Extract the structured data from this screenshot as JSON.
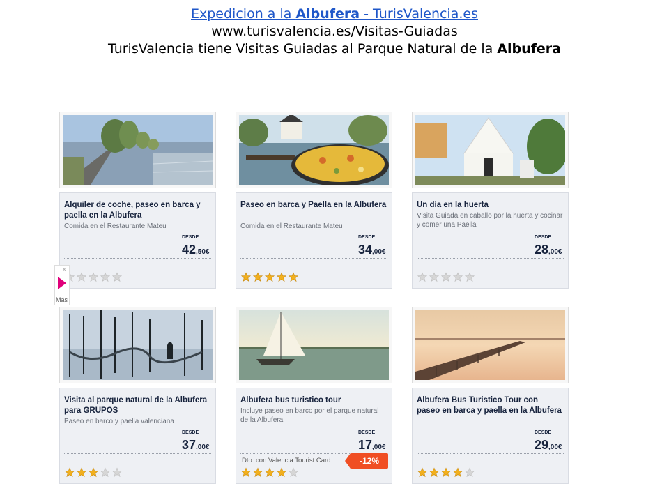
{
  "header": {
    "link_prefix": "Expedicion a la ",
    "link_bold": "Albufera",
    "link_suffix": " - TurisValencia.es",
    "url": "www.turisvalencia.es/Visitas-Guiadas",
    "desc_prefix": "TurisValencia tiene Visitas Guiadas al Parque Natural de la ",
    "desc_bold": "Albufera"
  },
  "side_tab": {
    "close": "×",
    "label": "Más"
  },
  "cards": [
    {
      "title": "Alquiler de coche, paseo en barca y paella en la Albufera",
      "subtitle": "Comida en el Restaurante Mateu",
      "desde": "DESDE",
      "price_int": "42",
      "price_dec": ",50€",
      "rating": 0,
      "promo": "",
      "badge": ""
    },
    {
      "title": "Paseo en barca y Paella en la Albufera",
      "subtitle": "Comida en el Restaurante Mateu",
      "desde": "DESDE",
      "price_int": "34",
      "price_dec": ",00€",
      "rating": 5,
      "promo": "",
      "badge": ""
    },
    {
      "title": "Un día en la huerta",
      "subtitle": "Visita Guiada en caballo por la huerta y cocinar y comer una Paella",
      "desde": "DESDE",
      "price_int": "28",
      "price_dec": ",00€",
      "rating": 0,
      "promo": "",
      "badge": ""
    },
    {
      "title": "Visita al parque natural de la Albufera para GRUPOS",
      "subtitle": "Paseo en barco y paella valenciana",
      "desde": "DESDE",
      "price_int": "37",
      "price_dec": ",00€",
      "rating": 3,
      "promo": "",
      "badge": ""
    },
    {
      "title": "Albufera bus turistico tour",
      "subtitle": "Incluye paseo en barco por el parque natural de la Albufera",
      "desde": "DESDE",
      "price_int": "17",
      "price_dec": ",00€",
      "rating": 4,
      "promo": "Dto. con Valencia Tourist Card",
      "badge": "-12%"
    },
    {
      "title": "Albufera Bus Turistico Tour con paseo en barca y paella en la Albufera",
      "subtitle": "",
      "desde": "DESDE",
      "price_int": "29",
      "price_dec": ",00€",
      "rating": 4,
      "promo": "",
      "badge": ""
    }
  ],
  "colors": {
    "link": "#1f57c9",
    "star_on": "#f2b01e",
    "star_off": "#d6d6d6",
    "badge": "#f04e23",
    "tab_play": "#e0007a"
  }
}
